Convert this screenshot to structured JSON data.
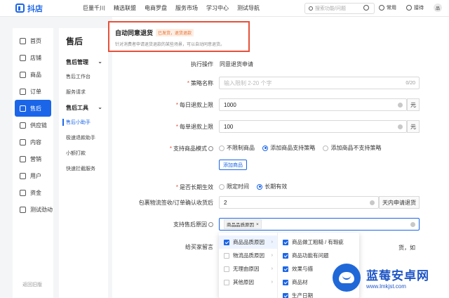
{
  "app": {
    "name": "抖店"
  },
  "topnav": [
    "巨量千川",
    "精选联盟",
    "电商罗盘",
    "服务市场",
    "学习中心",
    "测试导航"
  ],
  "search": {
    "placeholder": "搜索功能/问题"
  },
  "top_right": {
    "common": "常用",
    "service": "接待",
    "avatar_text": "品"
  },
  "sidebar": {
    "items": [
      {
        "label": "首页",
        "icon": "home-icon"
      },
      {
        "label": "店铺",
        "icon": "store-icon"
      },
      {
        "label": "商品",
        "icon": "product-icon"
      },
      {
        "label": "订单",
        "icon": "order-icon"
      },
      {
        "label": "售后",
        "icon": "after-sale-icon"
      },
      {
        "label": "供应链",
        "icon": "supply-chain-icon"
      },
      {
        "label": "内容",
        "icon": "content-icon"
      },
      {
        "label": "营销",
        "icon": "marketing-icon"
      },
      {
        "label": "用户",
        "icon": "user-icon"
      },
      {
        "label": "资金",
        "icon": "funds-icon"
      },
      {
        "label": "测试劲动",
        "icon": "test-icon"
      }
    ],
    "active_index": 4,
    "footer": "返回旧版"
  },
  "submenu": {
    "title": "售后",
    "group1": "售后管理",
    "links1": [
      "售后工作台",
      "服务请求"
    ],
    "group2": "售后工具",
    "links2": [
      "售后小助手",
      "极速退款助手",
      "小额打款",
      "快速拦截服务"
    ],
    "active_link": "售后小助手"
  },
  "callout": {
    "title": "自动同意退货",
    "tag": "已发货，退货退款",
    "desc": "针对消费者申请退货退款的某些场景，可以自动同意退货。"
  },
  "form": {
    "exec_label": "执行操作",
    "exec_value": "同意退货申请",
    "strategy_label": "策略名称",
    "strategy_placeholder": "输入限制 2-20 个字",
    "strategy_count": "0/20",
    "daily_label": "每日退款上限",
    "daily_value": "1000",
    "daily_unit": "元",
    "single_label": "每单退款上限",
    "single_value": "100",
    "single_unit": "元",
    "mode_label": "支持商品模式",
    "mode_options": [
      "不限制商品",
      "添加商品支持策略",
      "添加商品不支持策略"
    ],
    "mode_selected": 1,
    "add_product_btn": "添加商品",
    "longterm_label": "是否长期生效",
    "longterm_options": [
      "限定时间",
      "长期有效"
    ],
    "longterm_selected": 1,
    "logistics_label": "包裹物流签收/订单确认收货后",
    "logistics_value": "2",
    "logistics_unit": "天内申请退货",
    "reason_label": "支持售后原因",
    "reason_tag": "商品品质原因",
    "message_label": "给买家留言",
    "message_trunc": "货，如"
  },
  "cascader": {
    "col1": [
      {
        "label": "商品品质原因",
        "checked": true
      },
      {
        "label": "物流品质原因",
        "checked": false
      },
      {
        "label": "无理由原因",
        "checked": false
      },
      {
        "label": "其他原因",
        "checked": false
      }
    ],
    "col2": [
      {
        "label": "商品做工粗糙 / 有瑕疵",
        "checked": true
      },
      {
        "label": "商品功能有问题",
        "checked": true
      },
      {
        "label": "效果与描",
        "checked": true
      },
      {
        "label": "商品材",
        "checked": true
      },
      {
        "label": "生产日期",
        "checked": true
      }
    ]
  },
  "watermark": {
    "title": "蓝莓安卓网",
    "url": "www.lmkjst.com"
  },
  "colors": {
    "primary": "#1b66e8",
    "highlight_border": "#e8503a",
    "tag": "#e56d2c"
  }
}
